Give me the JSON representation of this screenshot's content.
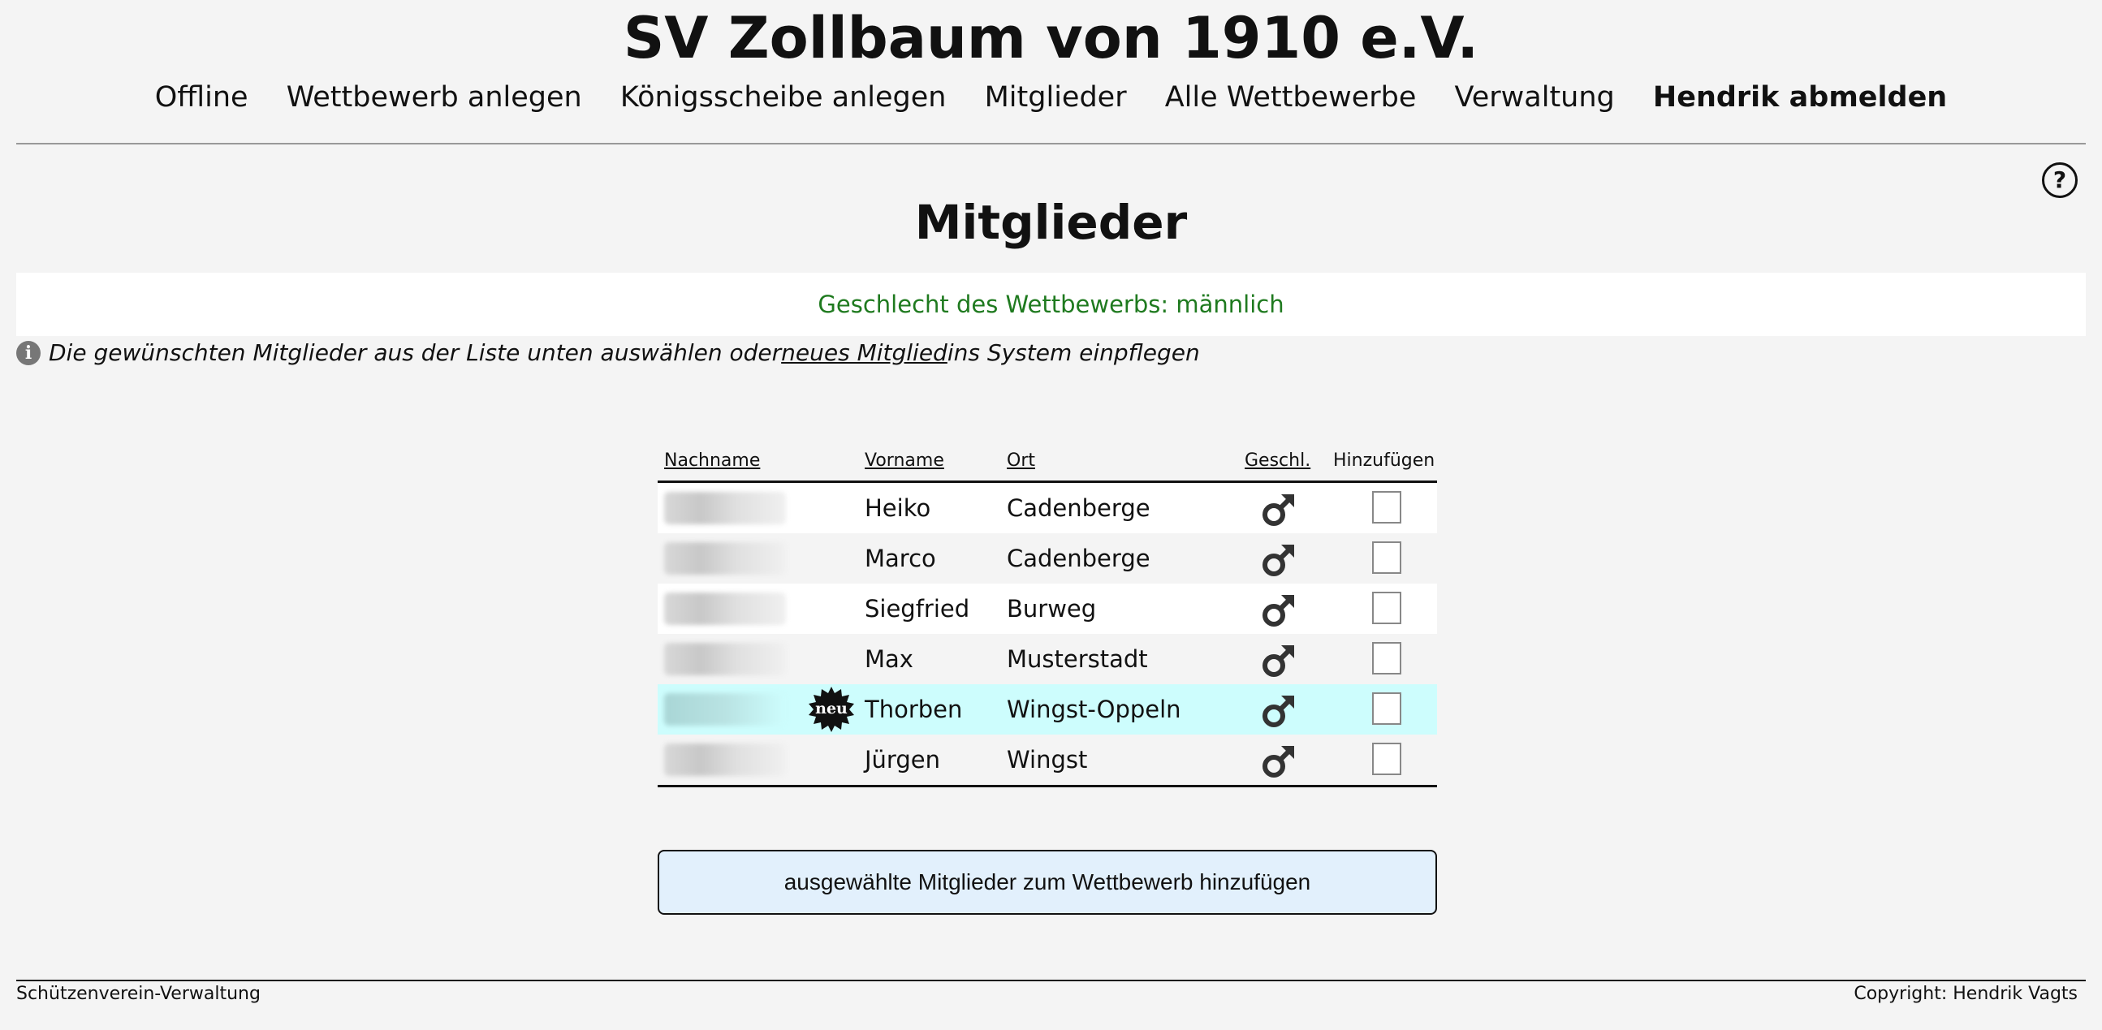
{
  "site": {
    "title": "SV Zollbaum von 1910 e.V."
  },
  "nav": {
    "items": [
      {
        "label": "Offline"
      },
      {
        "label": "Wettbewerb anlegen"
      },
      {
        "label": "Königsscheibe anlegen"
      },
      {
        "label": "Mitglieder"
      },
      {
        "label": "Alle Wettbewerbe"
      },
      {
        "label": "Verwaltung"
      },
      {
        "label": "Hendrik abmelden"
      }
    ]
  },
  "help": {
    "glyph": "?",
    "icon": "question-circle-icon"
  },
  "page": {
    "heading": "Mitglieder",
    "gender_notice": "Geschlecht des Wettbewerbs: männlich",
    "hint_before": "Die gewünschten Mitglieder aus der Liste unten auswählen oder ",
    "hint_link": "neues Mitglied ",
    "hint_after": "ins System einpflegen",
    "info_glyph": "i"
  },
  "table": {
    "headers": {
      "lastname": "Nachname",
      "firstname": "Vorname",
      "city": "Ort",
      "sex": "Geschl.",
      "add": "Hinzufügen"
    },
    "rows": [
      {
        "firstname": "Heiko",
        "city": "Cadenberge",
        "sex": "male",
        "new": false,
        "checked": false
      },
      {
        "firstname": "Marco",
        "city": "Cadenberge",
        "sex": "male",
        "new": false,
        "checked": false
      },
      {
        "firstname": "Siegfried",
        "city": "Burweg",
        "sex": "male",
        "new": false,
        "checked": false
      },
      {
        "firstname": "Max",
        "city": "Musterstadt",
        "sex": "male",
        "new": false,
        "checked": false
      },
      {
        "firstname": "Thorben",
        "city": "Wingst-Oppeln",
        "sex": "male",
        "new": true,
        "checked": false
      },
      {
        "firstname": "Jürgen",
        "city": "Wingst",
        "sex": "male",
        "new": false,
        "checked": false
      }
    ],
    "new_badge_text": "neu"
  },
  "submit": {
    "label": "ausgewählte Mitglieder zum Wettbewerb hinzufügen"
  },
  "footer": {
    "left": "Schützenverein-Verwaltung",
    "right": "Copyright: Hendrik Vagts"
  },
  "colors": {
    "background": "#f4f4f4",
    "notice_text": "#1f7a1f",
    "new_row": "#cdfdfd",
    "button_bg": "#e2f0fc"
  }
}
